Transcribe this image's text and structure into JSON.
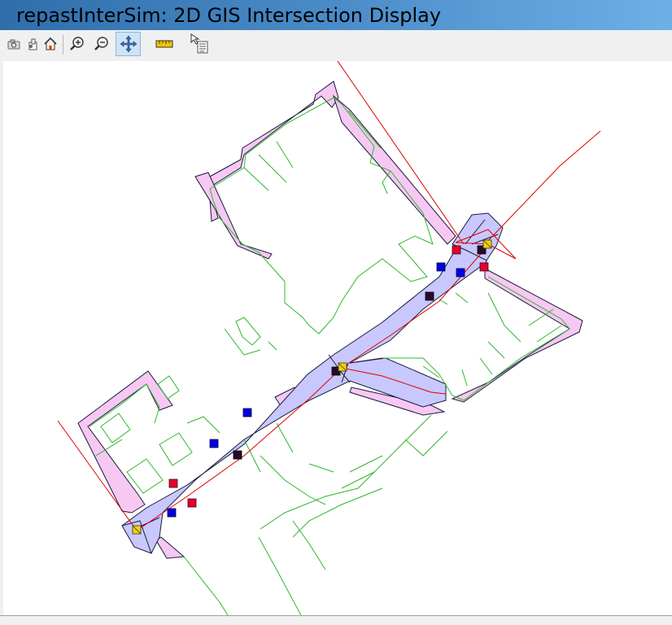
{
  "window": {
    "title": "repastInterSim: 2D GIS Intersection Display"
  },
  "toolbar": {
    "buttons": [
      {
        "name": "snapshot-button",
        "icon": "camera-icon"
      },
      {
        "name": "save-button",
        "icon": "export-icon"
      },
      {
        "name": "home-button",
        "icon": "home-icon"
      },
      {
        "name": "zoom-in-button",
        "icon": "zoom-in-icon"
      },
      {
        "name": "zoom-out-button",
        "icon": "zoom-out-icon"
      },
      {
        "name": "pan-button",
        "icon": "pan-arrows-icon",
        "active": true
      },
      {
        "name": "measure-button",
        "icon": "ruler-icon"
      },
      {
        "name": "info-button",
        "icon": "info-pointer-icon"
      }
    ]
  },
  "map": {
    "colors": {
      "pavement_fill": "#f7c8f3",
      "road_fill": "#c8c8ff",
      "building_line": "#2eb82e",
      "route_line": "#e00000",
      "outline": "#1a1a3a",
      "agent_red": "#e8002a",
      "agent_blue": "#0000e0",
      "agent_dark": "#2a0a2a",
      "crossing_yellow": "#f5d000"
    },
    "legend_markers": {
      "red_agents": 5,
      "blue_agents": 6,
      "dark_agents": 5,
      "crossings": 3
    }
  }
}
